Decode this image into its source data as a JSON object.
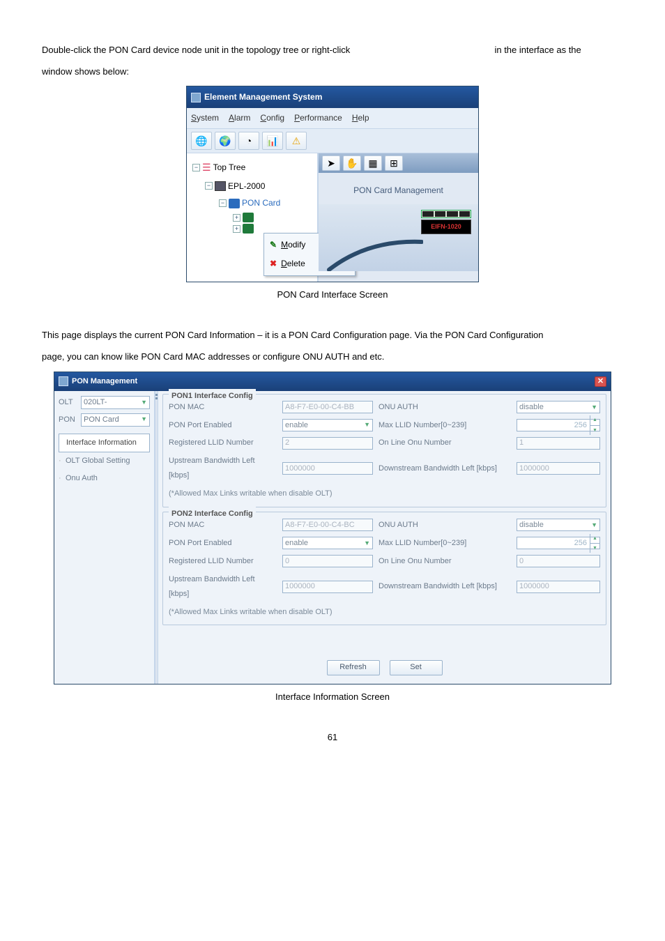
{
  "intro": {
    "line1_pre": "Double-click the PON Card device node unit in the topology tree or right-click",
    "line1_post": "in the interface as the",
    "line2": "window shows below:"
  },
  "fig1": {
    "window_title": "Element Management System",
    "menubar": [
      "System",
      "Alarm",
      "Config",
      "Performance",
      "Help"
    ],
    "tree": {
      "root": "Top Tree",
      "node1": "EPL-2000",
      "node2": "PON Card"
    },
    "context_menu": {
      "modify": "Modify",
      "delete": "Delete"
    },
    "right_label": "PON Card Management",
    "device_label": "EIFN-1020",
    "caption": "PON Card Interface Screen"
  },
  "para": {
    "l1": "This page displays the current PON Card Information – it is a PON Card Configuration page. Via the PON Card Configuration",
    "l2": "page, you can know like PON Card MAC addresses or configure ONU AUTH and etc."
  },
  "fig2": {
    "window_title": "PON Management",
    "left": {
      "olt_label": "OLT",
      "olt_value": "020LT-",
      "pon_label": "PON",
      "pon_value": "PON Card",
      "nav": [
        "Interface Information",
        "OLT Global Setting",
        "Onu Auth"
      ]
    },
    "pon1": {
      "legend": "PON1 Interface Config",
      "mac_label": "PON MAC",
      "mac_value": "A8-F7-E0-00-C4-BB",
      "onu_auth_label": "ONU AUTH",
      "onu_auth_value": "disable",
      "port_enabled_label": "PON Port Enabled",
      "port_enabled_value": "enable",
      "max_llid_label": "Max LLID Number[0~239]",
      "max_llid_value": "256",
      "reg_llid_label": "Registered LLID Number",
      "reg_llid_value": "2",
      "online_onu_label": "On Line Onu Number",
      "online_onu_value": "1",
      "up_bw_label": "Upstream Bandwidth Left [kbps]",
      "up_bw_value": "1000000",
      "down_bw_label": "Downstream Bandwidth Left [kbps]",
      "down_bw_value": "1000000",
      "note": "(*Allowed Max Links writable when disable OLT)"
    },
    "pon2": {
      "legend": "PON2 Interface Config",
      "mac_label": "PON MAC",
      "mac_value": "A8-F7-E0-00-C4-BC",
      "onu_auth_label": "ONU AUTH",
      "onu_auth_value": "disable",
      "port_enabled_label": "PON Port Enabled",
      "port_enabled_value": "enable",
      "max_llid_label": "Max LLID Number[0~239]",
      "max_llid_value": "256",
      "reg_llid_label": "Registered LLID Number",
      "reg_llid_value": "0",
      "online_onu_label": "On Line Onu Number",
      "online_onu_value": "0",
      "up_bw_label": "Upstream Bandwidth Left [kbps]",
      "up_bw_value": "1000000",
      "down_bw_label": "Downstream Bandwidth Left [kbps]",
      "down_bw_value": "1000000",
      "note": "(*Allowed Max Links writable when disable OLT)"
    },
    "buttons": {
      "refresh": "Refresh",
      "set": "Set"
    },
    "caption": "Interface Information Screen"
  },
  "page_number": "61"
}
